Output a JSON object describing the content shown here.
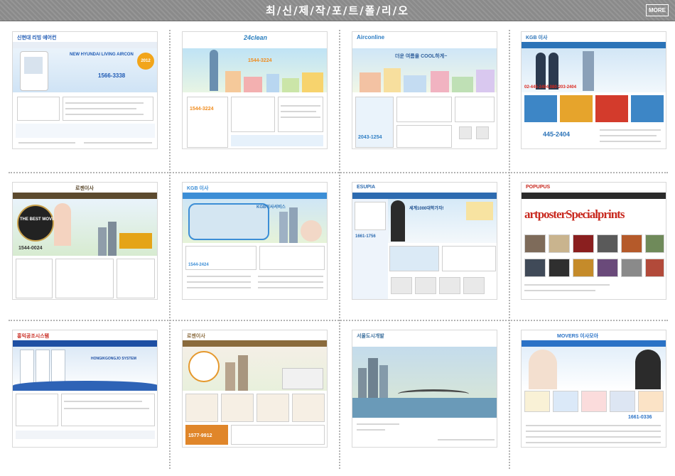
{
  "header": {
    "title": "최/신/제/작/포/트/폴/리/오",
    "more_label": "MORE"
  },
  "portfolio": [
    {
      "logo": "신현대 리빙 에어컨",
      "hero": "NEW HYUNDAI LIVING AIRCON",
      "phone": "1566-3338",
      "badge": "2012",
      "accent": "#1e5ab4"
    },
    {
      "logo": "24clean",
      "hero": "1544-3224",
      "phone": "1544-3224",
      "accent": "#4aa6d6"
    },
    {
      "logo": "Airconline",
      "hero": "더운 여름을 COOL하게~",
      "phone": "2043-1254",
      "accent": "#2f7ec4"
    },
    {
      "logo": "KGB 이사",
      "hero": "02-445-2404,080-203-2404",
      "phone": "445-2404",
      "accent": "#2b73b8"
    },
    {
      "logo": "로젠이사",
      "hero": "THE BEST MOVING",
      "phone": "1544-0024",
      "accent": "#5c4a2e"
    },
    {
      "logo": "KGB 이사",
      "hero": "KGB이사서비스",
      "phone": "1544-2424",
      "accent": "#3c8ed6"
    },
    {
      "logo": "ESUPIA",
      "hero": "세계1000대학가자!",
      "phone": "1661-1756",
      "accent": "#2d6bb0"
    },
    {
      "logo": "POPUPUS",
      "hero": "artposterSpecialprints",
      "phone": "",
      "accent": "#c8281e"
    },
    {
      "logo": "홍익공조시스템",
      "hero": "HONGIKGONGJO SYSTEM",
      "phone": "",
      "accent": "#1e4fa3"
    },
    {
      "logo": "로젠이사",
      "hero": "1577-9912",
      "phone": "1577-9912",
      "accent": "#8a6a3c"
    },
    {
      "logo": "서울도시개발",
      "hero": "",
      "phone": "",
      "accent": "#3a6e9c"
    },
    {
      "logo": "MOVERS 이사모아",
      "hero": "1661-0336",
      "phone": "1661-0336",
      "accent": "#2a72c6"
    }
  ]
}
